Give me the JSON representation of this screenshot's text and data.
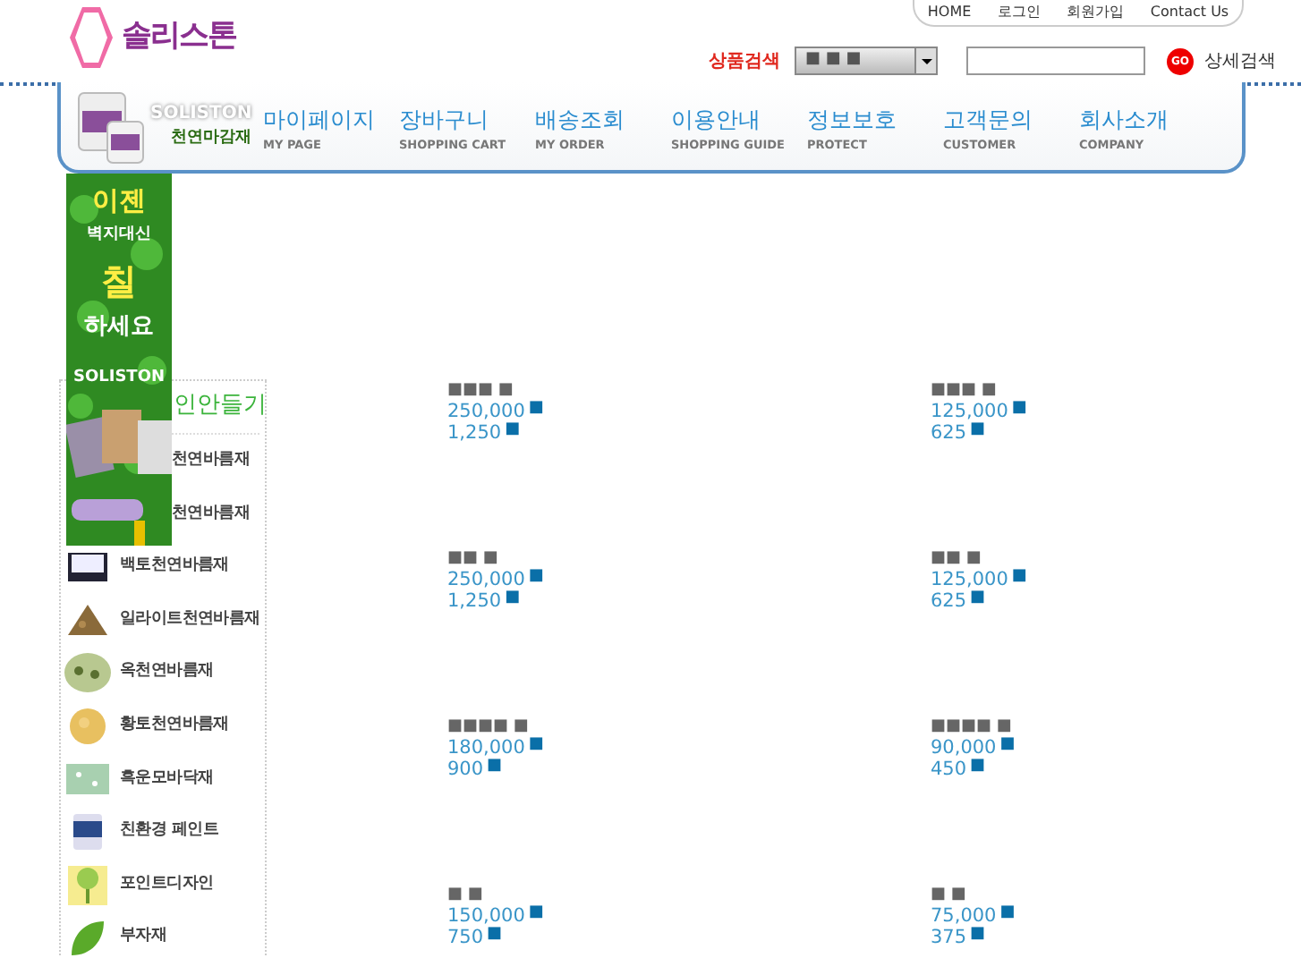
{
  "logo": {
    "text": "솔리스톤"
  },
  "top_links": [
    "HOME",
    "로그인",
    "회원가입",
    "Contact Us"
  ],
  "search": {
    "label": "상품검색",
    "category": "■ ■ ■",
    "go": "GO",
    "advanced": "상세검색"
  },
  "brand": {
    "name": "SOLISTON",
    "tagline": "천연마감재"
  },
  "nav": [
    {
      "label": "마이페이지",
      "sub": "MY PAGE"
    },
    {
      "label": "장바구니",
      "sub": "SHOPPING CART"
    },
    {
      "label": "배송조회",
      "sub": "MY ORDER"
    },
    {
      "label": "이용안내",
      "sub": "SHOPPING GUIDE"
    },
    {
      "label": "정보보호",
      "sub": "PROTECT"
    },
    {
      "label": "고객문의",
      "sub": "CUSTOMER"
    },
    {
      "label": "회사소개",
      "sub": "COMPANY"
    }
  ],
  "banner": {
    "lines": [
      "이젠",
      "벽지대신",
      "칠",
      "하세요",
      "SOLISTON"
    ]
  },
  "sidebar": {
    "heading": "인안들기",
    "items": [
      {
        "label": "천연바름재"
      },
      {
        "label": "천연바름재"
      },
      {
        "label": "백토천연바름재"
      },
      {
        "label": "일라이트천연바름재"
      },
      {
        "label": "옥천연바름재"
      },
      {
        "label": "황토천연바름재"
      },
      {
        "label": "흑운모바닥재"
      },
      {
        "label": "친환경 페인트"
      },
      {
        "label": "포인트디자인"
      },
      {
        "label": "부자재"
      }
    ]
  },
  "products": [
    {
      "name": "■■■ ■",
      "price": "250,000",
      "price_unit": "■",
      "points": "1,250",
      "points_unit": "■"
    },
    {
      "name": "■■■ ■",
      "price": "125,000",
      "price_unit": "■",
      "points": "625",
      "points_unit": "■"
    },
    {
      "name": "■■ ■",
      "price": "250,000",
      "price_unit": "■",
      "points": "1,250",
      "points_unit": "■"
    },
    {
      "name": "■■ ■",
      "price": "125,000",
      "price_unit": "■",
      "points": "625",
      "points_unit": "■"
    },
    {
      "name": "■■■■ ■",
      "price": "180,000",
      "price_unit": "■",
      "points": "900",
      "points_unit": "■"
    },
    {
      "name": "■■■■ ■",
      "price": "90,000",
      "price_unit": "■",
      "points": "450",
      "points_unit": "■"
    },
    {
      "name": "■ ■",
      "price": "150,000",
      "price_unit": "■",
      "points": "750",
      "points_unit": "■"
    },
    {
      "name": "■ ■",
      "price": "75,000",
      "price_unit": "■",
      "points": "375",
      "points_unit": "■"
    }
  ]
}
